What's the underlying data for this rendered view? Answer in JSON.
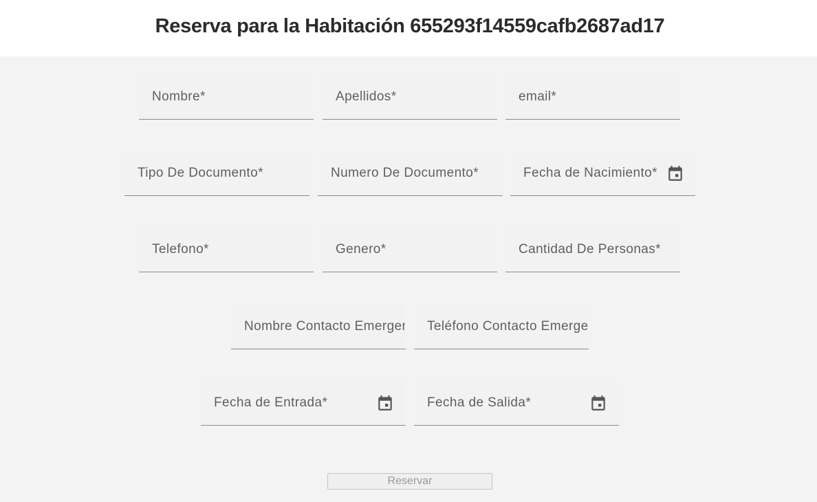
{
  "page": {
    "title": "Reserva para la Habitación 655293f14559cafb2687ad17"
  },
  "form": {
    "row1": {
      "nombre": "Nombre*",
      "apellidos": "Apellidos*",
      "email": "email*"
    },
    "row2": {
      "tipo_documento": "Tipo De Documento*",
      "numero_documento": "Numero De Documento*",
      "fecha_nacimiento": "Fecha de Nacimiento*"
    },
    "row3": {
      "telefono": "Telefono*",
      "genero": "Genero*",
      "cantidad_personas": "Cantidad De Personas*"
    },
    "row4": {
      "nombre_contacto_emergencia": "Nombre Contacto Emergencia*",
      "telefono_contacto_emergencia": "Teléfono Contacto Emergencia*"
    },
    "row5": {
      "fecha_entrada": "Fecha de Entrada*",
      "fecha_salida": "Fecha de Salida*"
    },
    "submit_label": "Reservar"
  },
  "icons": {
    "calendar": "calendar-icon"
  },
  "colors": {
    "background": "#f3f3f3",
    "title_text": "#2b2b2b",
    "label_text": "#5f5f5f",
    "underline": "#8a8a8a"
  }
}
